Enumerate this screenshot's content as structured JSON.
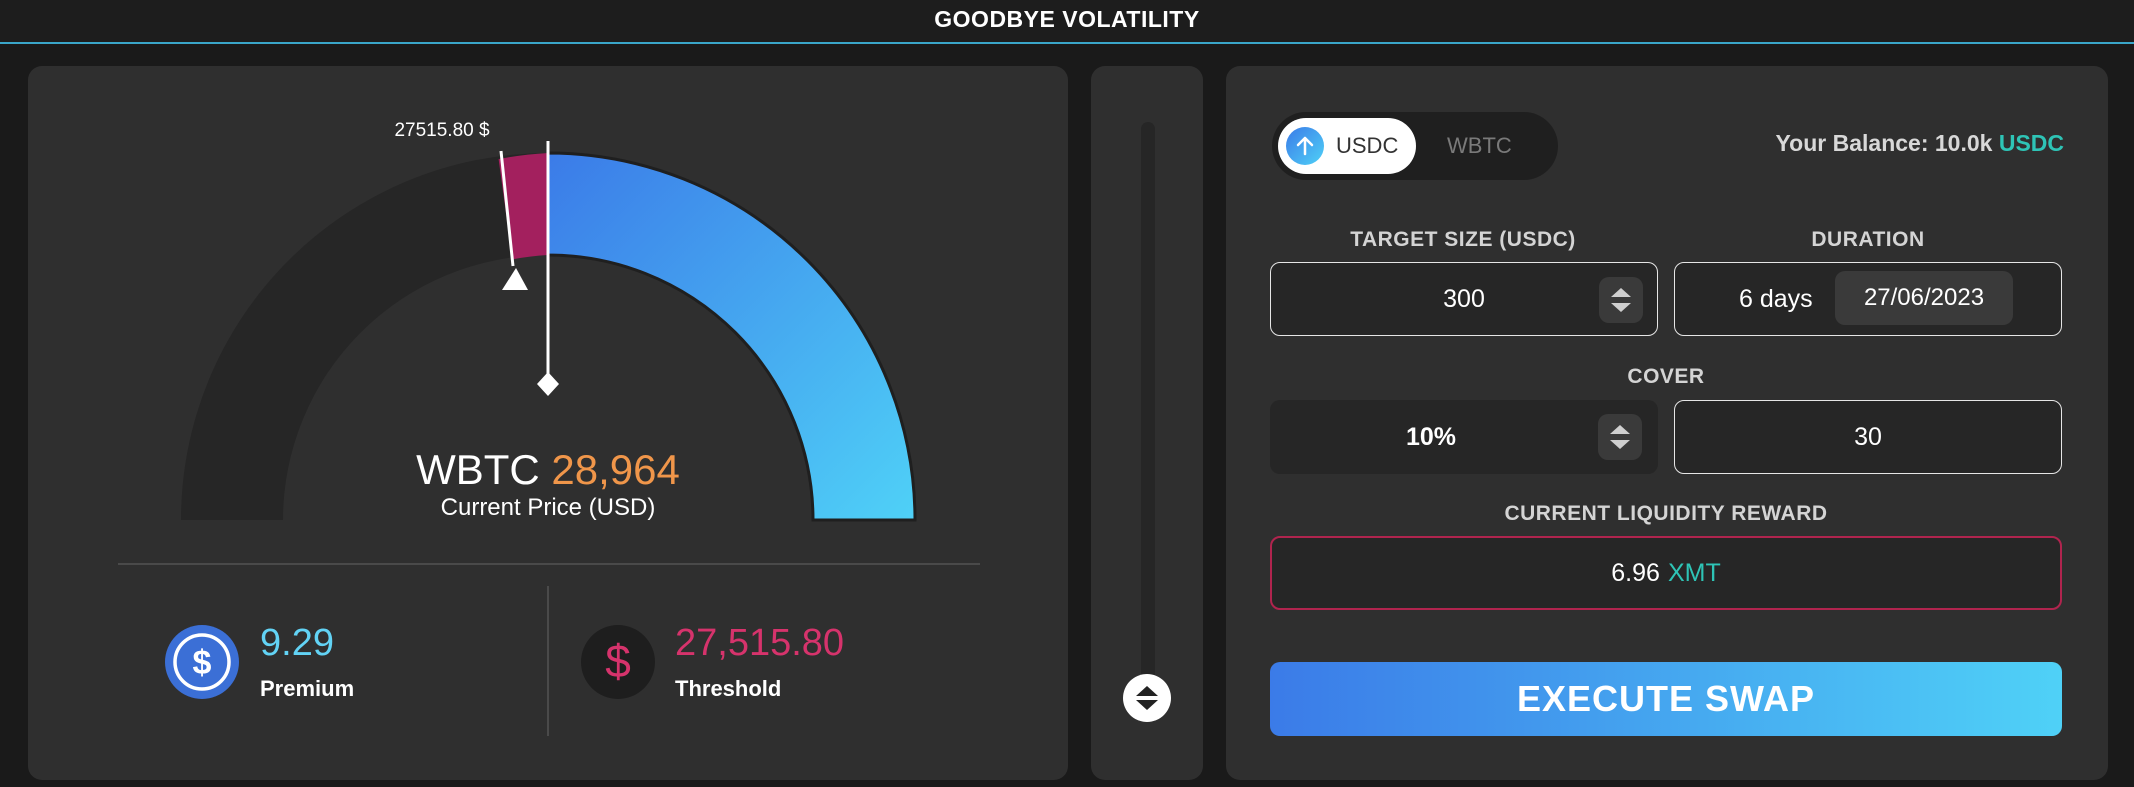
{
  "header": {
    "title": "GOODBYE VOLATILITY"
  },
  "gauge": {
    "threshold_marker_label": "27515.80 $",
    "asset": "WBTC",
    "price": "28,964",
    "price_caption": "Current Price (USD)"
  },
  "stats": {
    "premium": {
      "value": "9.29",
      "label": "Premium",
      "icon": "usdc-coin-icon"
    },
    "threshold": {
      "value": "27,515.80",
      "label": "Threshold",
      "icon": "dollar-icon"
    }
  },
  "swap": {
    "toggle": {
      "selected": "USDC",
      "other": "WBTC"
    },
    "balance": {
      "prefix": "Your Balance: 10.0k",
      "currency": "USDC"
    },
    "target_size": {
      "label": "TARGET SIZE (USDC)",
      "value": "300"
    },
    "duration": {
      "label": "DURATION",
      "days": "6 days",
      "date": "27/06/2023"
    },
    "cover": {
      "label": "COVER",
      "percent": "10%",
      "amount": "30"
    },
    "reward": {
      "label": "CURRENT LIQUIDITY REWARD",
      "value": "6.96",
      "currency": "XMT"
    },
    "execute_label": "EXECUTE SWAP"
  },
  "colors": {
    "accent_blue": "#3b7be8",
    "accent_cyan": "#4fd1f7",
    "threshold_pink": "#d6336c",
    "price_orange": "#f0964a",
    "teal": "#2ec4b6"
  }
}
